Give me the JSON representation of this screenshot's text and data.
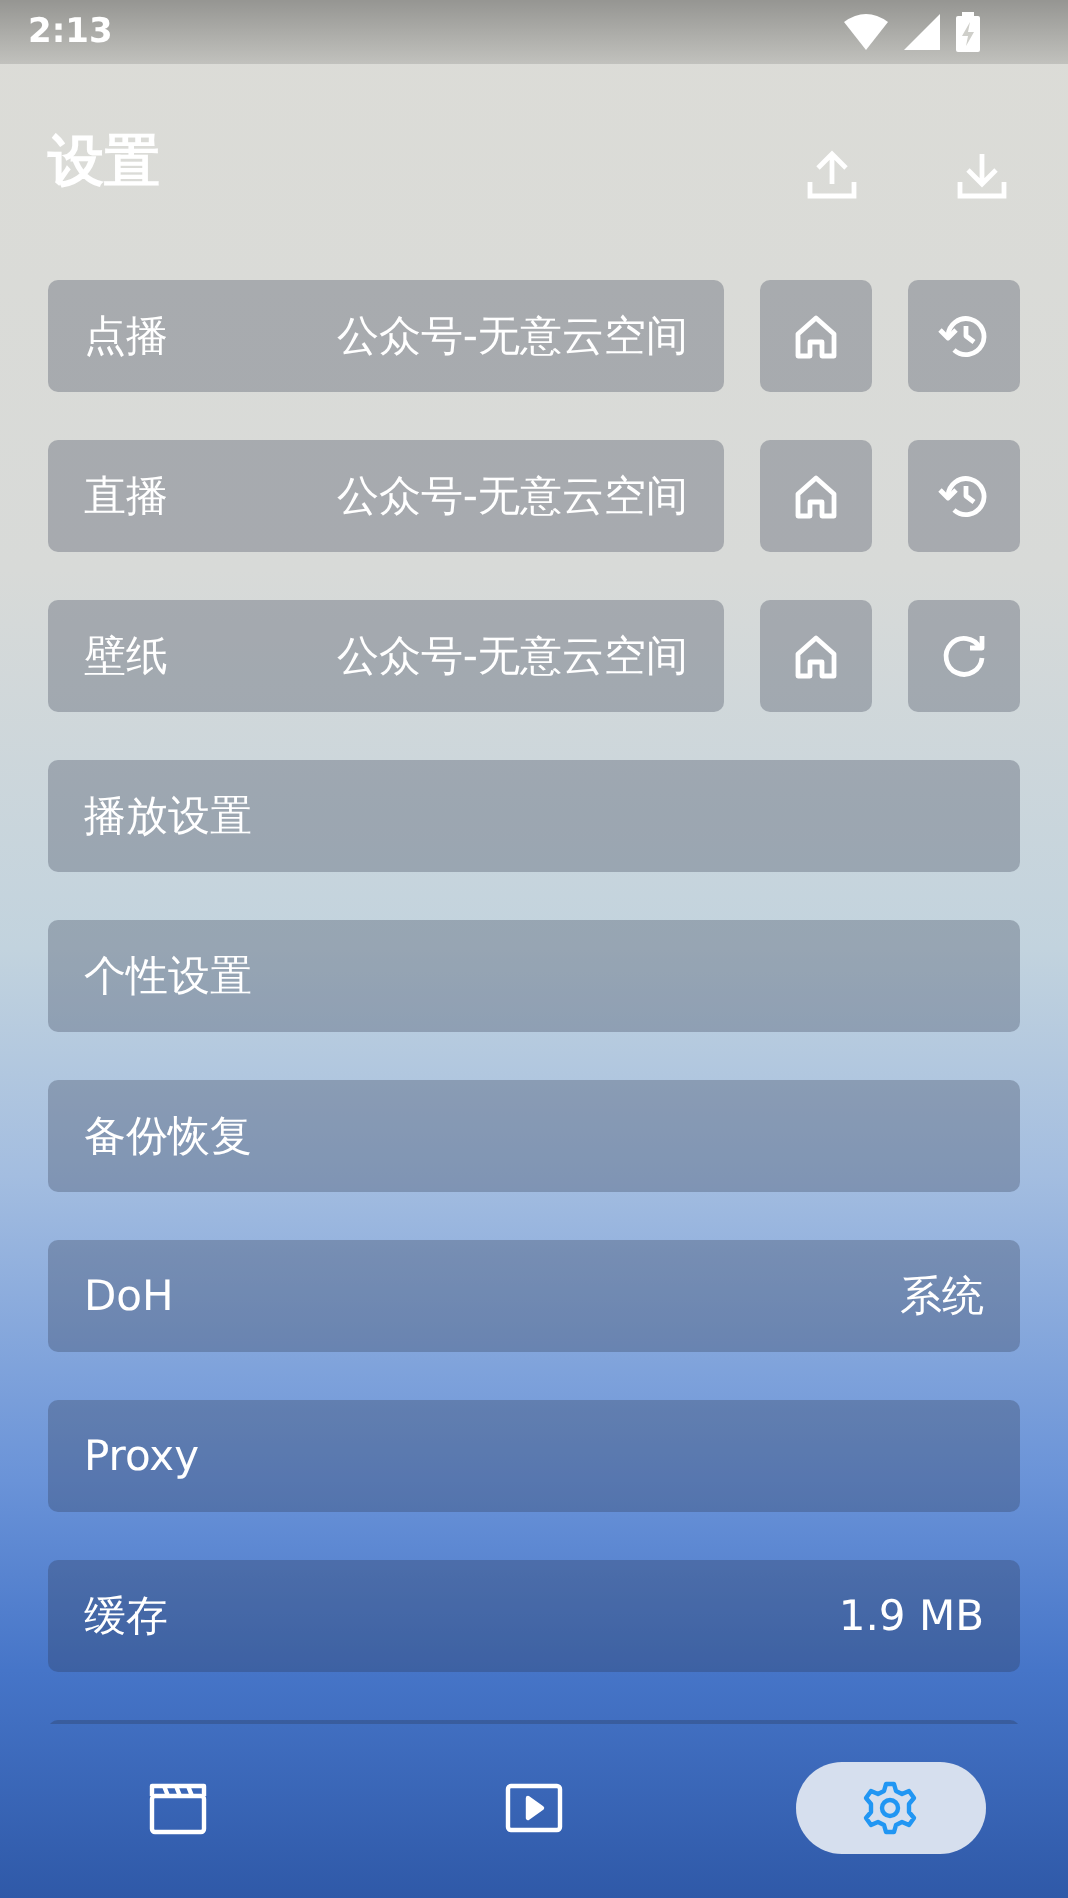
{
  "status_bar": {
    "time": "2:13"
  },
  "header": {
    "title": "设置"
  },
  "sources": [
    {
      "label": "点播",
      "value": "公众号-无意云空间",
      "kind": "history"
    },
    {
      "label": "直播",
      "value": "公众号-无意云空间",
      "kind": "history"
    },
    {
      "label": "壁纸",
      "value": "公众号-无意云空间",
      "kind": "refresh"
    }
  ],
  "settings": [
    {
      "label": "播放设置"
    },
    {
      "label": "个性设置"
    },
    {
      "label": "备份恢复"
    },
    {
      "label": "DoH",
      "value": "系统"
    },
    {
      "label": "Proxy"
    },
    {
      "label": "缓存",
      "value": "1.9 MB"
    }
  ],
  "nav": [
    {
      "kind": "movies",
      "selected": false
    },
    {
      "kind": "play",
      "selected": false
    },
    {
      "kind": "settings",
      "selected": true
    }
  ]
}
